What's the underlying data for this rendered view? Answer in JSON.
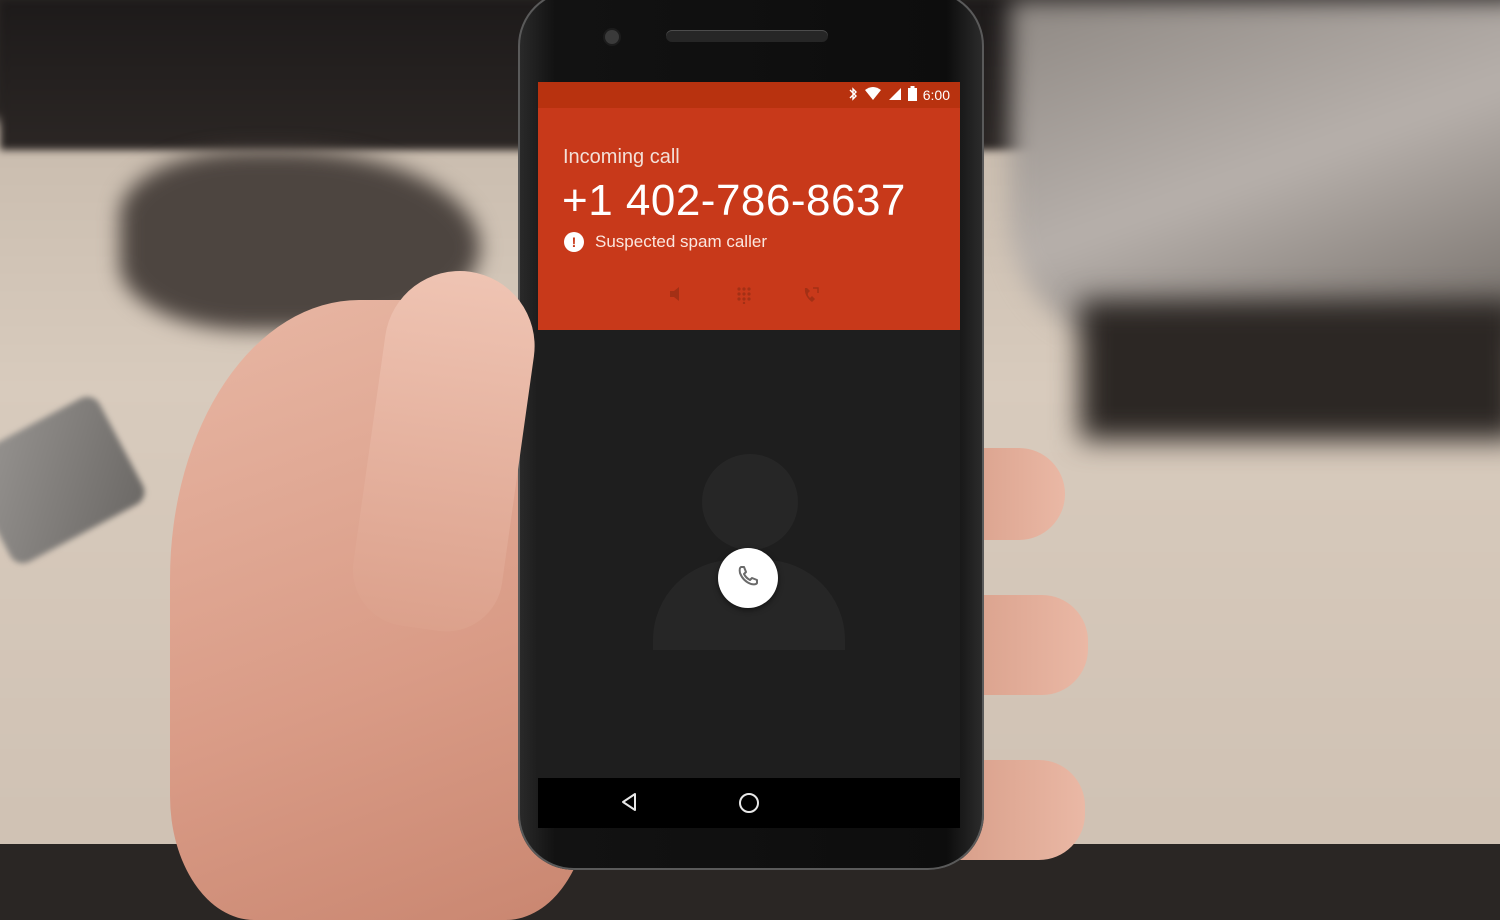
{
  "status_bar": {
    "time": "6:00",
    "icons": [
      "bluetooth-icon",
      "wifi-icon",
      "signal-icon",
      "battery-icon"
    ]
  },
  "call": {
    "label": "Incoming call",
    "number": "+1 402-786-8637",
    "spam_warning": "Suspected spam caller"
  },
  "header_actions": [
    "speaker-icon",
    "dialpad-icon",
    "call-forward-icon"
  ],
  "answer": {
    "icon": "phone-icon"
  },
  "navbar": [
    "back-icon",
    "home-icon"
  ],
  "colors": {
    "header_bg": "#c8391a",
    "status_bg": "#b8320f",
    "screen_bg": "#1e1e1e"
  }
}
